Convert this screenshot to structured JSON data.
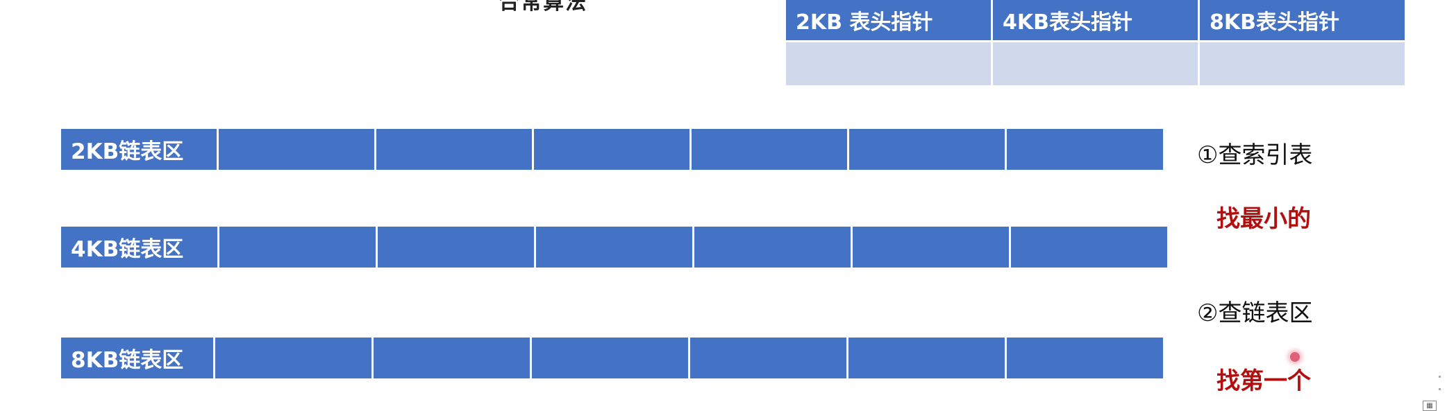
{
  "header": {
    "clipped_title": "合常算法"
  },
  "index_table": {
    "headers": [
      "2KB  表头指针",
      "4KB表头指针",
      "8KB表头指针"
    ]
  },
  "lists": [
    {
      "label": "2KB链表区"
    },
    {
      "label": "4KB链表区"
    },
    {
      "label": "8KB链表区"
    }
  ],
  "steps": {
    "step1": "①查索引表",
    "hint1": "找最小的",
    "step2": "②查链表区",
    "hint2": "找第一个"
  },
  "colors": {
    "block_blue": "#4472c4",
    "light_cell": "#d0d8ec",
    "hint_red": "#b01010"
  },
  "icons": {
    "corner": "grid-icon",
    "cursor": "cursor-dot"
  }
}
